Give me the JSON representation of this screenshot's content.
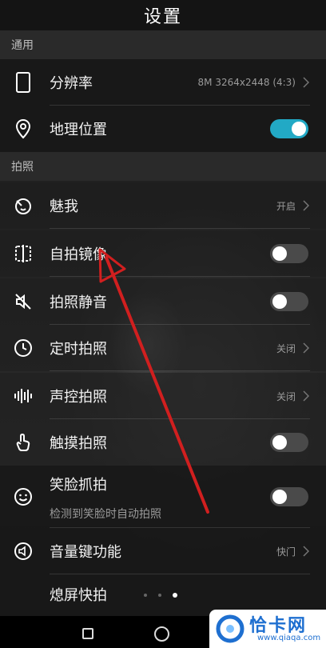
{
  "title": "设置",
  "sections": {
    "general": "通用",
    "capture": "拍照"
  },
  "rows": {
    "resolution": {
      "label": "分辨率",
      "value": "8M 3264x2448 (4:3)"
    },
    "location": {
      "label": "地理位置",
      "toggle_on": true
    },
    "beauty": {
      "label": "魅我",
      "value": "开启"
    },
    "mirror": {
      "label": "自拍镜像",
      "toggle_on": false
    },
    "mute": {
      "label": "拍照静音",
      "toggle_on": false
    },
    "timer": {
      "label": "定时拍照",
      "value": "关闭"
    },
    "voice": {
      "label": "声控拍照",
      "value": "关闭"
    },
    "touch": {
      "label": "触摸拍照",
      "toggle_on": false
    },
    "smile": {
      "label": "笑脸抓拍",
      "sublabel": "检测到笑脸时自动拍照",
      "toggle_on": false
    },
    "volume": {
      "label": "音量键功能",
      "value": "快门"
    },
    "snapshot": {
      "label": "熄屏快拍"
    }
  },
  "pager": {
    "count": 3,
    "active": 3
  },
  "colors": {
    "accent": "#22a9c5",
    "annotation_arrow": "#d11f1f",
    "watermark_blue": "#1e6fd0"
  },
  "watermark": {
    "title": "恰卡网",
    "url": "www.qiaqa.com"
  }
}
